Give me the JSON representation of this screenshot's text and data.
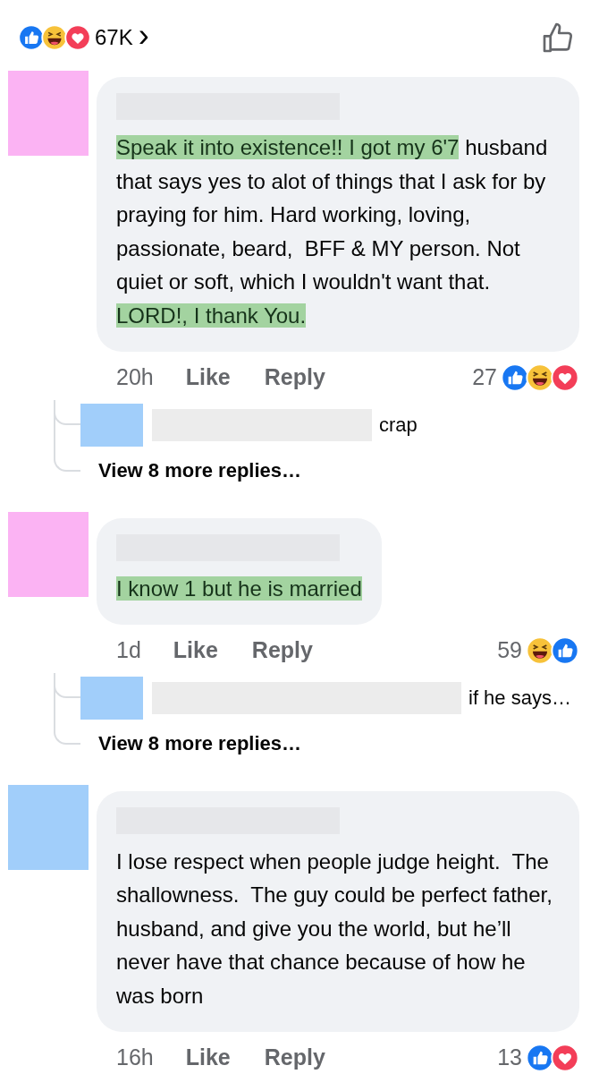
{
  "header": {
    "reactions": [
      {
        "kind": "like"
      },
      {
        "kind": "haha"
      },
      {
        "kind": "love"
      }
    ],
    "count": "67K",
    "chevron": "›"
  },
  "comments": [
    {
      "avatar": {
        "color": "#fbb3f3"
      },
      "segments": [
        {
          "text": "Speak it into existence!! ",
          "highlighted": true
        },
        {
          "text": "I got my 6'7",
          "highlighted": true
        },
        {
          "text": " husband that says yes to alot of things that I ask for by praying for him. Hard working, loving, passionate, beard,  BFF & MY person. Not quiet or soft, which I wouldn't want that.  ",
          "highlighted": false
        },
        {
          "text": "LORD!, I thank You.",
          "highlighted": true
        }
      ],
      "time": "20h",
      "like": "Like",
      "reply": "Reply",
      "reaction_count": "27",
      "reactions": [
        {
          "kind": "like"
        },
        {
          "kind": "haha"
        },
        {
          "kind": "love"
        }
      ],
      "replies": [
        {
          "avatar": {
            "color": "#a1cefa"
          },
          "text": "crap"
        }
      ],
      "more": "View 8 more replies…"
    },
    {
      "avatar": {
        "color": "#fbb3f3"
      },
      "segments": [
        {
          "text": "I know 1 but he is married",
          "highlighted": true
        }
      ],
      "time": "1d",
      "like": "Like",
      "reply": "Reply",
      "reaction_count": "59",
      "reactions": [
        {
          "kind": "haha"
        },
        {
          "kind": "like"
        }
      ],
      "replies": [
        {
          "avatar": {
            "color": "#a1cefa"
          },
          "text": "if he says…"
        }
      ],
      "more": "View 8 more replies…"
    },
    {
      "avatar": {
        "color": "#a1cefa"
      },
      "segments": [
        {
          "text": "I lose respect when people judge height.  The shallowness.  The guy could be perfect father, husband, and give you the world, but he’ll never have that chance because of how he was born",
          "highlighted": false
        }
      ],
      "time": "16h",
      "like": "Like",
      "reply": "Reply",
      "reaction_count": "13",
      "reactions": [
        {
          "kind": "like"
        },
        {
          "kind": "love"
        }
      ]
    }
  ]
}
